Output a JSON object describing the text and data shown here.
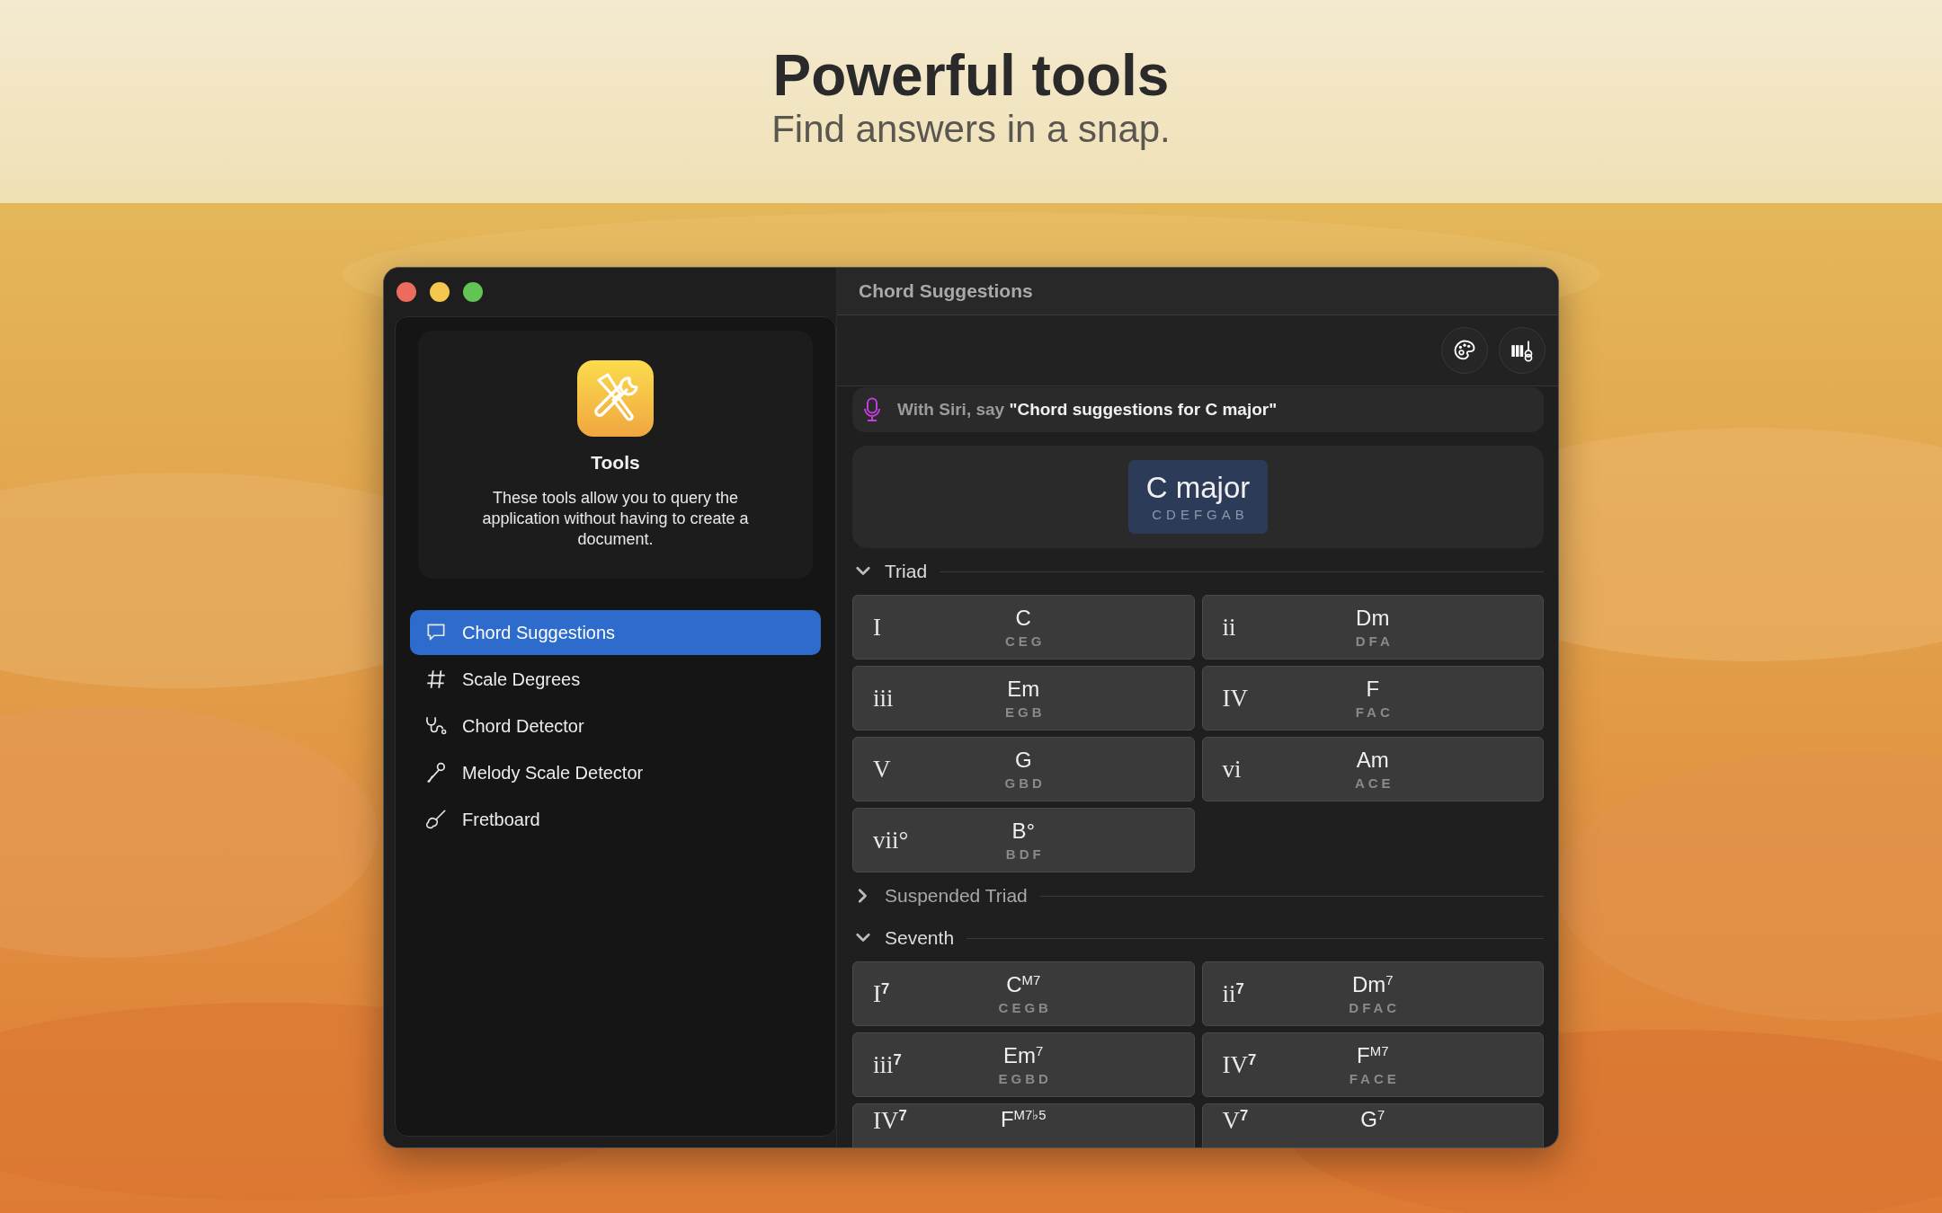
{
  "banner": {
    "title": "Powerful tools",
    "subtitle": "Find answers in a snap."
  },
  "window": {
    "title": "Chord Suggestions"
  },
  "sidebar": {
    "card": {
      "title": "Tools",
      "description": "These tools allow you to query the application without having to create a document."
    },
    "items": [
      {
        "label": "Chord Suggestions",
        "selected": true
      },
      {
        "label": "Scale Degrees",
        "selected": false
      },
      {
        "label": "Chord Detector",
        "selected": false
      },
      {
        "label": "Melody Scale Detector",
        "selected": false
      },
      {
        "label": "Fretboard",
        "selected": false
      }
    ]
  },
  "siri_hint": "With Siri, say **\"Chord suggestions for C major\"**",
  "key": {
    "name": "C major",
    "notes": "CDEFGAB"
  },
  "sections": [
    {
      "title": "Triad",
      "expanded": true,
      "chords": [
        {
          "numeral": "I",
          "name": "C",
          "notes": "CEG"
        },
        {
          "numeral": "ii",
          "name": "Dm",
          "notes": "DFA"
        },
        {
          "numeral": "iii",
          "name": "Em",
          "notes": "EGB"
        },
        {
          "numeral": "IV",
          "name": "F",
          "notes": "FAC"
        },
        {
          "numeral": "V",
          "name": "G",
          "notes": "GBD"
        },
        {
          "numeral": "vi",
          "name": "Am",
          "notes": "ACE"
        },
        {
          "numeral": "vii°",
          "name": "B°",
          "notes": "BDF"
        }
      ]
    },
    {
      "title": "Suspended Triad",
      "expanded": false
    },
    {
      "title": "Seventh",
      "expanded": true,
      "chords": [
        {
          "numeral": "I$^{7}$",
          "name": "C$^{M7}$",
          "notes": "CEGB"
        },
        {
          "numeral": "ii$^{7}$",
          "name": "Dm$^{7}$",
          "notes": "DFAC"
        },
        {
          "numeral": "iii$^{7}$",
          "name": "Em$^{7}$",
          "notes": "EGBD"
        },
        {
          "numeral": "IV$^{7}$",
          "name": "F$^{M7}$",
          "notes": "FACE"
        },
        {
          "numeral": "IV$^{7}$",
          "name": "F$^{M7♭5}$"
        },
        {
          "numeral": "V$^{7}$",
          "name": "G$^{7}$"
        }
      ]
    }
  ]
}
